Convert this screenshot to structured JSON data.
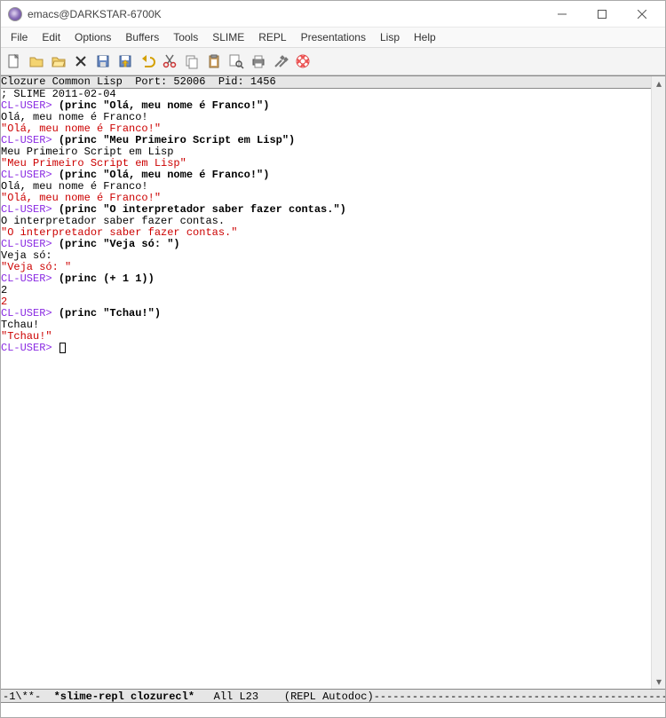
{
  "titlebar": {
    "title": "emacs@DARKSTAR-6700K"
  },
  "menu": {
    "items": [
      "File",
      "Edit",
      "Options",
      "Buffers",
      "Tools",
      "SLIME",
      "REPL",
      "Presentations",
      "Lisp",
      "Help"
    ]
  },
  "toolbar": {
    "icons": [
      "new-file-icon",
      "open-file-icon",
      "open-folder-icon",
      "close-icon",
      "save-icon",
      "save-as-icon",
      "undo-icon",
      "cut-icon",
      "copy-icon",
      "paste-icon",
      "search-icon",
      "print-icon",
      "preferences-icon",
      "help-icon"
    ]
  },
  "repl": {
    "header": "Clozure Common Lisp  Port: 52006  Pid: 1456",
    "banner": "; SLIME 2011-02-04",
    "prompt": "CL-USER>",
    "session": [
      {
        "input": "(princ \"Olá, meu nome é Franco!\")",
        "output": "Olá, meu nome é Franco!",
        "result": "\"Olá, meu nome é Franco!\""
      },
      {
        "input": "(princ \"Meu Primeiro Script em Lisp\")",
        "output": "Meu Primeiro Script em Lisp",
        "result": "\"Meu Primeiro Script em Lisp\""
      },
      {
        "input": "(princ \"Olá, meu nome é Franco!\")",
        "output": "Olá, meu nome é Franco!",
        "result": "\"Olá, meu nome é Franco!\""
      },
      {
        "input": "(princ \"O interpretador saber fazer contas.\")",
        "output": "O interpretador saber fazer contas.",
        "result": "\"O interpretador saber fazer contas.\""
      },
      {
        "input": "(princ \"Veja só: \")",
        "output": "Veja só:",
        "result": "\"Veja só: \""
      },
      {
        "input": "(princ (+ 1 1))",
        "output": "2",
        "result": "2"
      },
      {
        "input": "(princ \"Tchau!\")",
        "output": "Tchau!",
        "result": "\"Tchau!\""
      }
    ]
  },
  "modeline": {
    "left": "-1\\**-  ",
    "buffer": "*slime-repl clozurecl*",
    "pos": "   All L23   ",
    "mode": " (REPL Autodoc)",
    "dashes": "--------------------------------------------------------"
  }
}
